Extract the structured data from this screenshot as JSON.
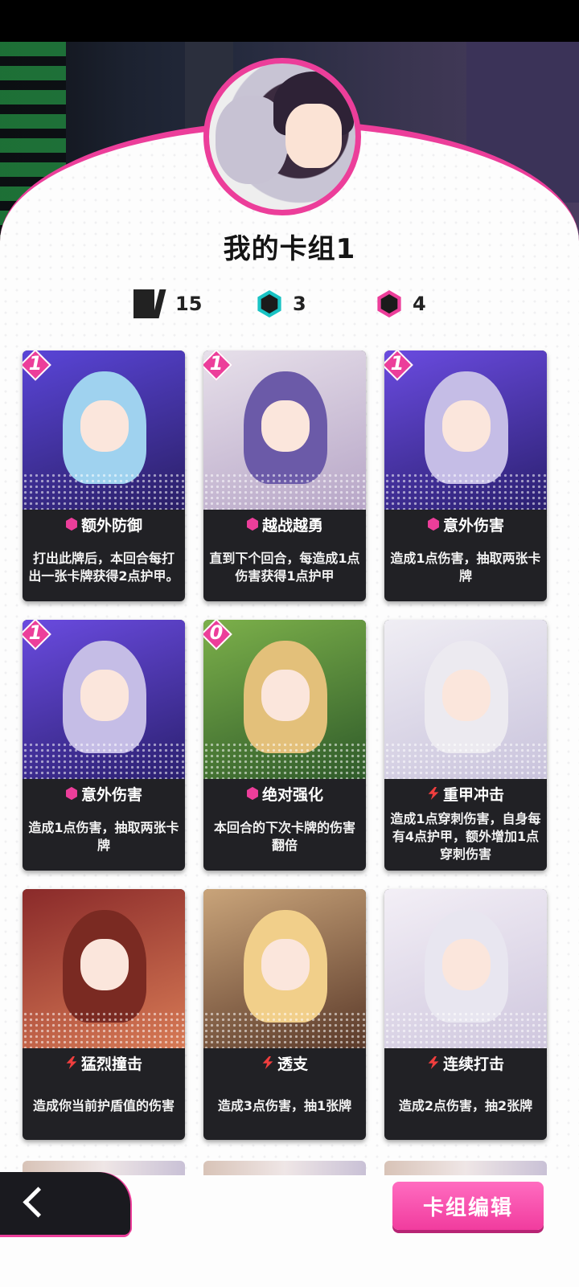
{
  "deck": {
    "title": "我的卡组1",
    "card_count": "15",
    "teal_count": "3",
    "pink_count": "4",
    "colors": {
      "accent": "#ec3e9a",
      "teal": "#19c3c4",
      "card_bg": "#212125"
    }
  },
  "cards": [
    {
      "cost": "1",
      "name": "额外防御",
      "icon": "shield-icon",
      "desc": "打出此牌后，本回合每打出一张卡牌获得2点护甲。",
      "art": [
        "#5a45d8",
        "#2a1f66"
      ],
      "hair": "#9fd2ef"
    },
    {
      "cost": "1",
      "name": "越战越勇",
      "icon": "shield-icon",
      "desc": "直到下个回合，每造成1点伤害获得1点护甲",
      "art": [
        "#e7e0ea",
        "#b7a6c7"
      ],
      "hair": "#6b5aa8"
    },
    {
      "cost": "1",
      "name": "意外伤害",
      "icon": "shield-icon",
      "desc": "造成1点伤害，抽取两张卡牌",
      "art": [
        "#6a4be0",
        "#2b2070"
      ],
      "hair": "#c5bde6"
    },
    {
      "cost": "1",
      "name": "意外伤害",
      "icon": "shield-icon",
      "desc": "造成1点伤害，抽取两张卡牌",
      "art": [
        "#6a4be0",
        "#2b2070"
      ],
      "hair": "#c5bde6"
    },
    {
      "cost": "0",
      "name": "绝对强化",
      "icon": "shield-icon",
      "desc": "本回合的下次卡牌的伤害翻倍",
      "art": [
        "#7cb04a",
        "#2f5b2a"
      ],
      "hair": "#e3c07a"
    },
    {
      "cost": "",
      "name": "重甲冲击",
      "icon": "bolt-icon",
      "desc": "造成1点穿刺伤害，自身每有4点护甲，额外增加1点穿刺伤害",
      "art": [
        "#f0eef4",
        "#c9c3dc"
      ],
      "hair": "#eceaf0"
    },
    {
      "cost": "",
      "name": "猛烈撞击",
      "icon": "bolt-icon",
      "desc": "造成你当前护盾值的伤害",
      "art": [
        "#8a2a2a",
        "#d77a55"
      ],
      "hair": "#7a2a22"
    },
    {
      "cost": "",
      "name": "透支",
      "icon": "bolt-icon",
      "desc": "造成3点伤害，抽1张牌",
      "art": [
        "#c9a47a",
        "#5b3a2a"
      ],
      "hair": "#f1cf8a"
    },
    {
      "cost": "",
      "name": "连续打击",
      "icon": "bolt-icon",
      "desc": "造成2点伤害，抽2张牌",
      "art": [
        "#f3eff6",
        "#cfc7de"
      ],
      "hair": "#e8e6f0"
    }
  ],
  "buttons": {
    "back_label": "",
    "edit_label": "卡组编辑"
  }
}
